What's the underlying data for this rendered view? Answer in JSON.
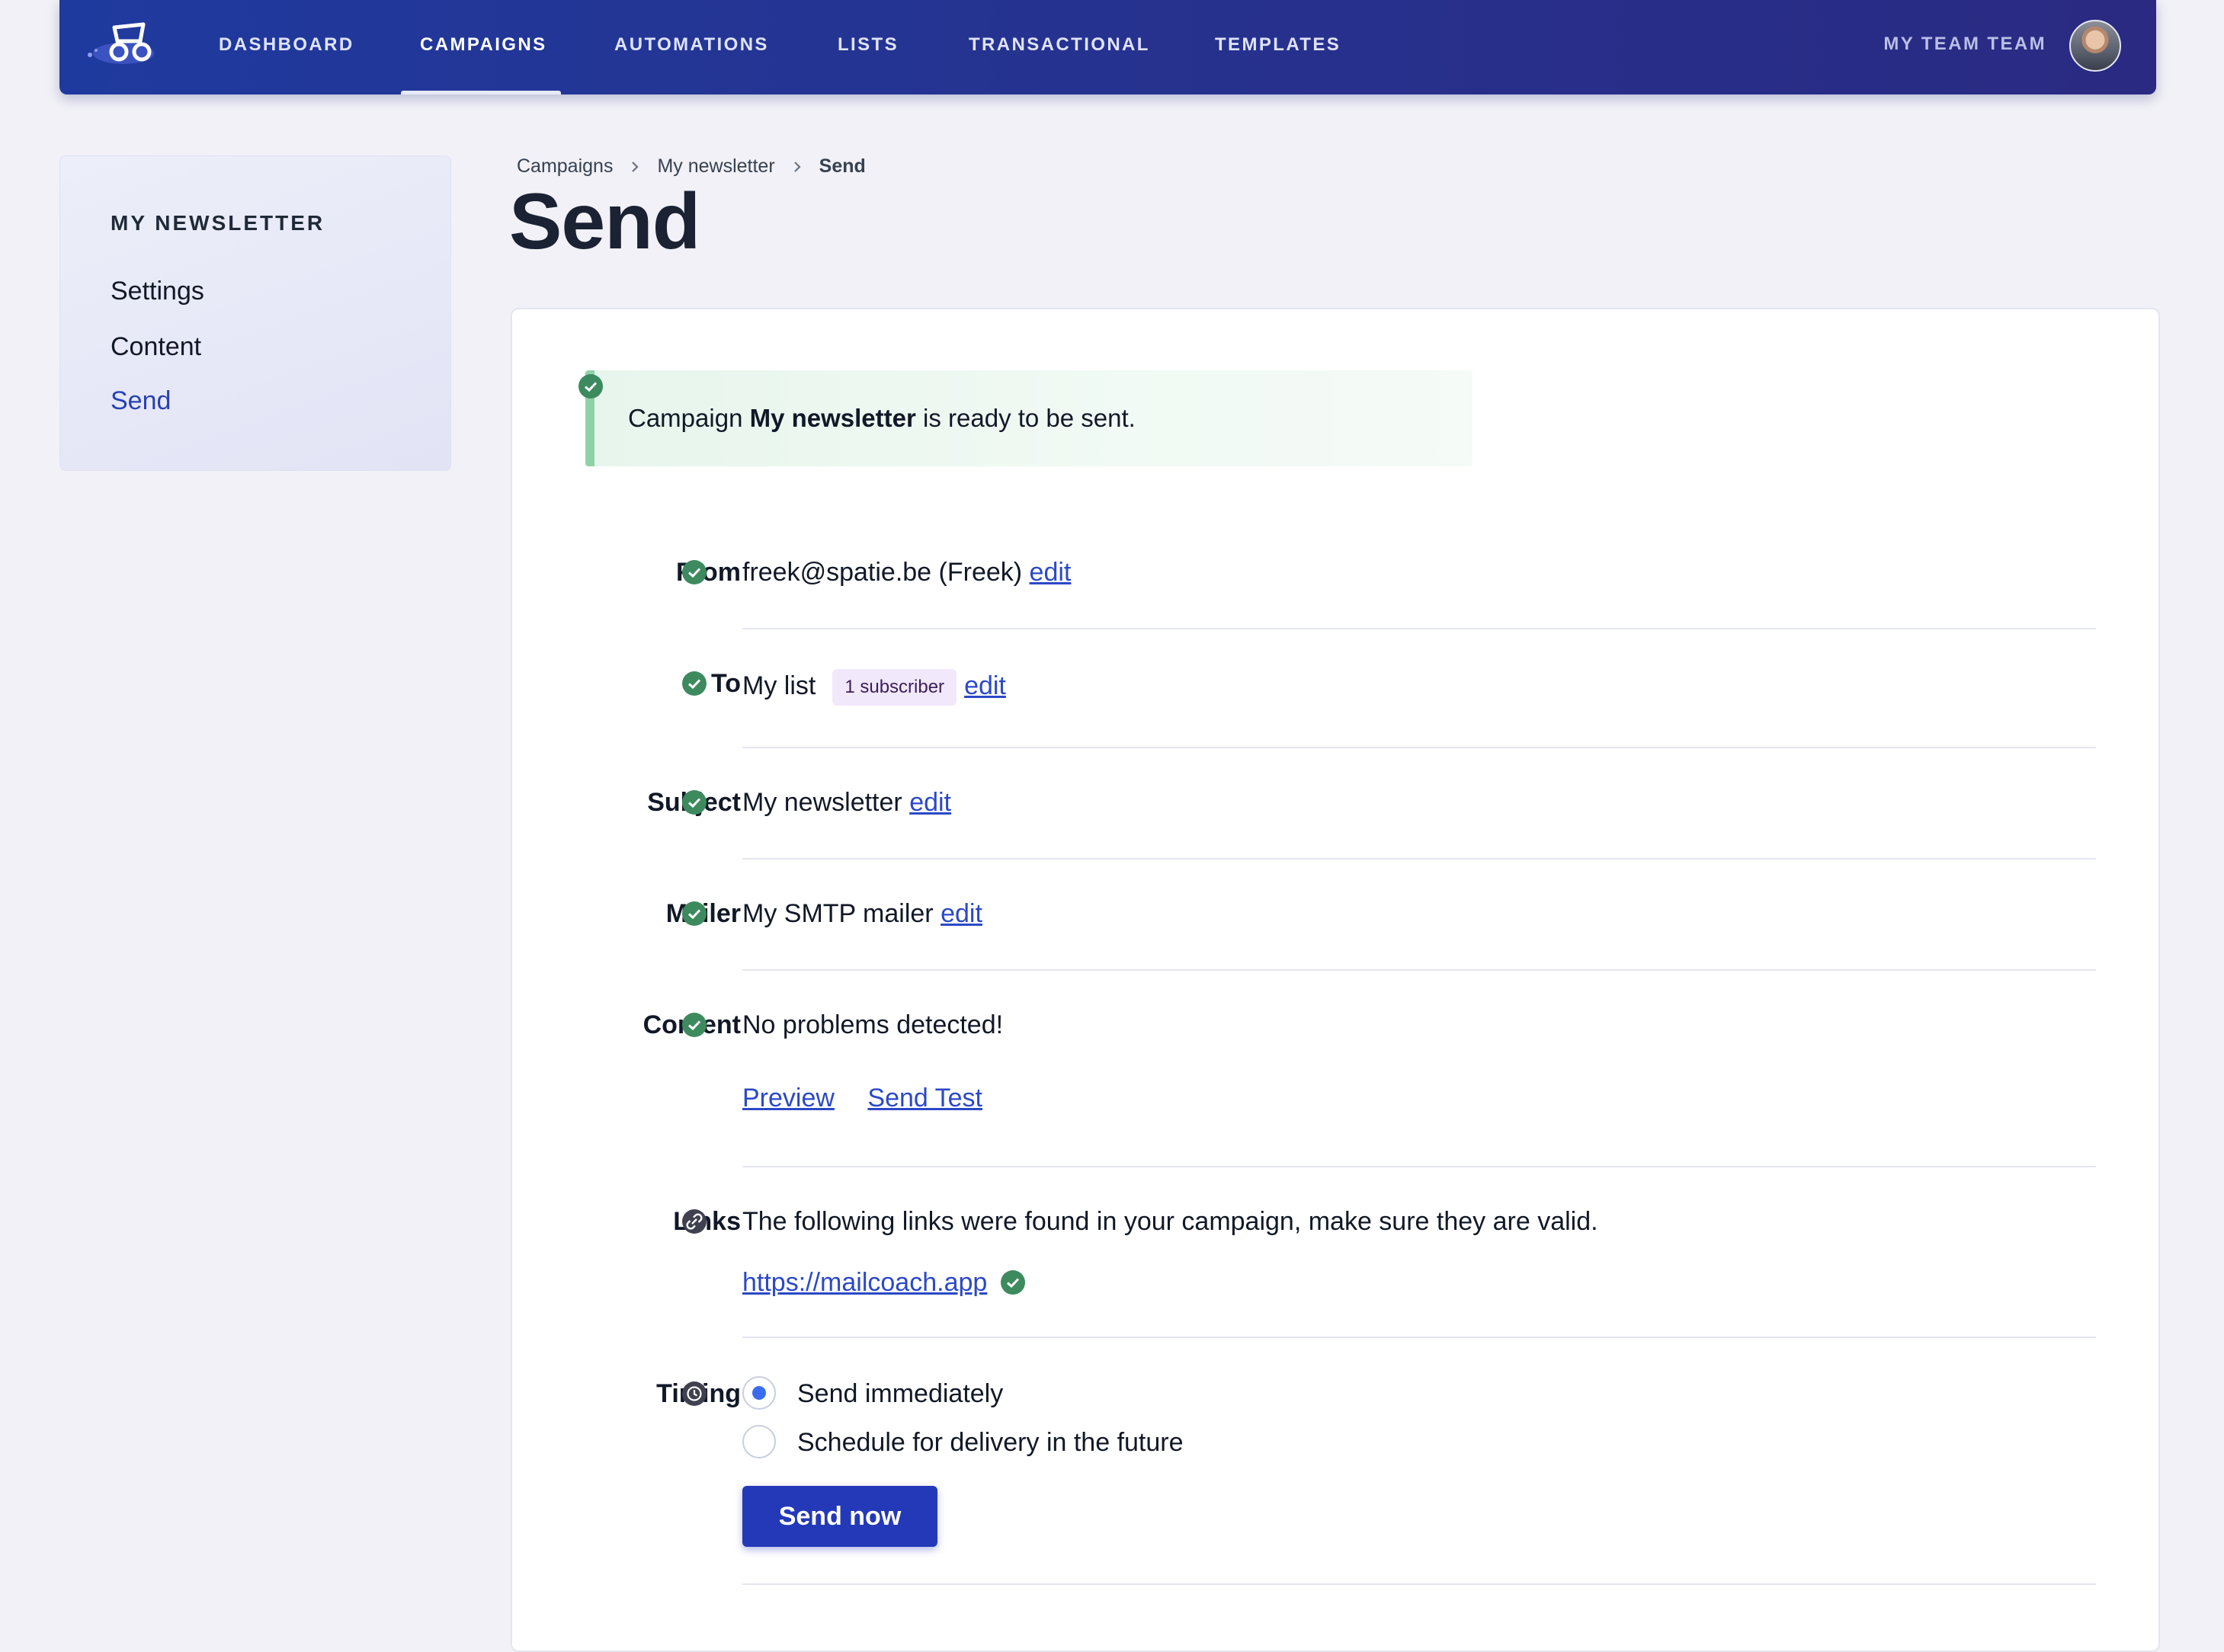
{
  "nav": {
    "items": [
      {
        "label": "DASHBOARD"
      },
      {
        "label": "CAMPAIGNS"
      },
      {
        "label": "AUTOMATIONS"
      },
      {
        "label": "LISTS"
      },
      {
        "label": "TRANSACTIONAL"
      },
      {
        "label": "TEMPLATES"
      }
    ],
    "active": "CAMPAIGNS",
    "team": "MY TEAM TEAM"
  },
  "sidebar": {
    "title": "MY NEWSLETTER",
    "items": [
      {
        "label": "Settings"
      },
      {
        "label": "Content"
      },
      {
        "label": "Send"
      }
    ],
    "active": "Send"
  },
  "breadcrumb": [
    "Campaigns",
    "My newsletter",
    "Send"
  ],
  "page_title": "Send",
  "alert": {
    "prefix": "Campaign",
    "campaign": "My newsletter",
    "suffix": "is ready to be sent."
  },
  "rows": {
    "from": {
      "label": "From",
      "value": "freek@spatie.be (Freek)",
      "action": "edit"
    },
    "to": {
      "label": "To",
      "value": "My list",
      "badge": "1 subscriber",
      "action": "edit"
    },
    "subject": {
      "label": "Subject",
      "value": "My newsletter",
      "action": "edit"
    },
    "mailer": {
      "label": "Mailer",
      "value": "My SMTP mailer",
      "action": "edit"
    },
    "content": {
      "label": "Content",
      "value": "No problems detected!",
      "preview": "Preview",
      "send_test": "Send Test"
    },
    "links": {
      "label": "Links",
      "value": "The following links were found in your campaign, make sure they are valid.",
      "url": "https://mailcoach.app"
    },
    "timing": {
      "label": "Timing",
      "options": [
        "Send immediately",
        "Schedule for delivery in the future"
      ],
      "selected": "Send immediately",
      "button": "Send now"
    }
  },
  "colors": {
    "nav_bg": "#26328f",
    "accent": "#2439b8",
    "link": "#2b49c6",
    "success": "#3d8a5e",
    "page_bg": "#f1f1f7"
  },
  "icons": {
    "ok": "check-circle-icon",
    "links": "link-icon",
    "timing": "clock-icon",
    "chevron": "chevron-right-icon"
  }
}
